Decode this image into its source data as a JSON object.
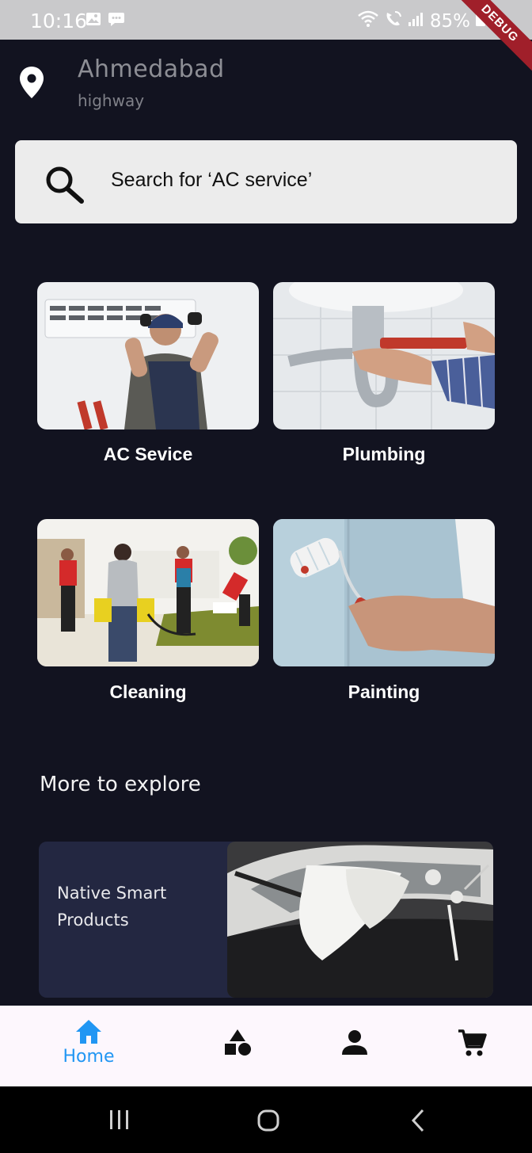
{
  "status_bar": {
    "time": "10:16",
    "battery": "85%",
    "debug_banner": "DEBUG"
  },
  "location": {
    "city": "Ahmedabad",
    "area": "highway"
  },
  "search": {
    "placeholder": "Search for ‘AC service’"
  },
  "services": [
    {
      "label": "AC Sevice",
      "icon": "ac-service-photo"
    },
    {
      "label": "Plumbing",
      "icon": "plumbing-photo"
    },
    {
      "label": "Cleaning",
      "icon": "cleaning-photo"
    },
    {
      "label": "Painting",
      "icon": "painting-photo"
    }
  ],
  "explore": {
    "title": "More to explore",
    "promo_label": "Native Smart Products"
  },
  "bottom_nav": {
    "items": [
      {
        "label": "Home",
        "icon": "home-icon",
        "active": true
      },
      {
        "label": "",
        "icon": "categories-icon",
        "active": false
      },
      {
        "label": "",
        "icon": "person-icon",
        "active": false
      },
      {
        "label": "",
        "icon": "cart-icon",
        "active": false
      }
    ]
  },
  "colors": {
    "background": "#121320",
    "accent": "#2196f3",
    "search_bg": "#ececec",
    "promo_bg": "#232741",
    "nav_bg": "#fdf7fd"
  }
}
